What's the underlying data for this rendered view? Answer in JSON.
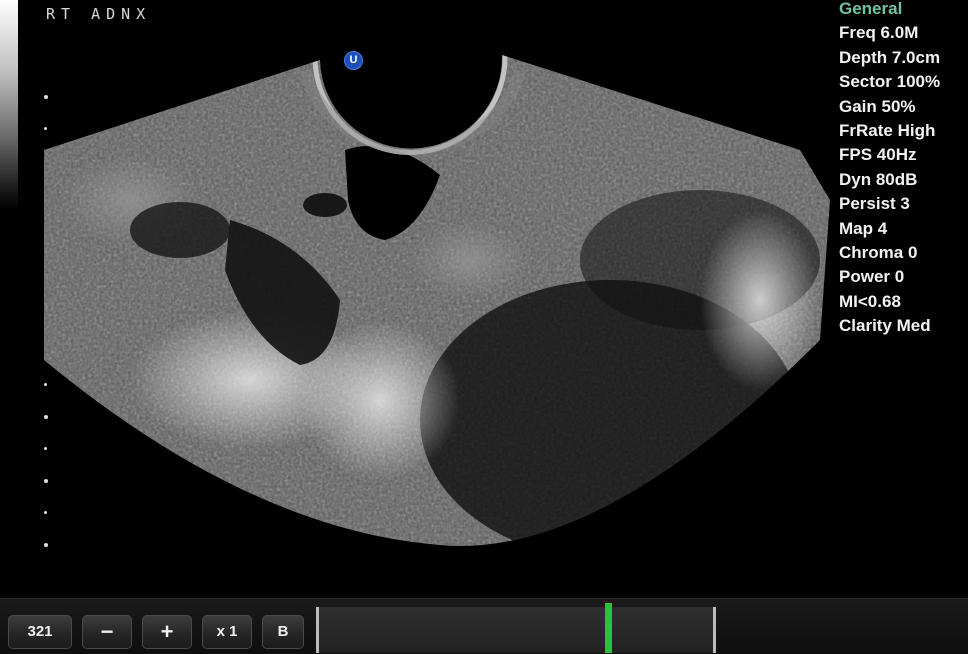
{
  "image_label": "RT ADNX",
  "orientation_marker": "U",
  "parameters": {
    "mode": "General",
    "rows": [
      "Freq 6.0M",
      "Depth 7.0cm",
      "Sector 100%",
      "Gain 50%",
      "FrRate High",
      "FPS 40Hz",
      "Dyn 80dB",
      "Persist 3",
      "Map 4",
      "Chroma 0",
      "Power 0",
      "MI<0.68",
      "Clarity Med"
    ]
  },
  "toolbar": {
    "frame_number": "321",
    "zoom_out_icon": "minus-icon",
    "zoom_in_icon": "plus-icon",
    "zoom_label": "x 1",
    "mode_label": "B"
  },
  "cine": {
    "position_fraction": 0.73
  },
  "colors": {
    "mode_accent": "#6fc2a1",
    "cine_marker": "#27c43a",
    "orientation_marker": "#1d4fb8"
  }
}
